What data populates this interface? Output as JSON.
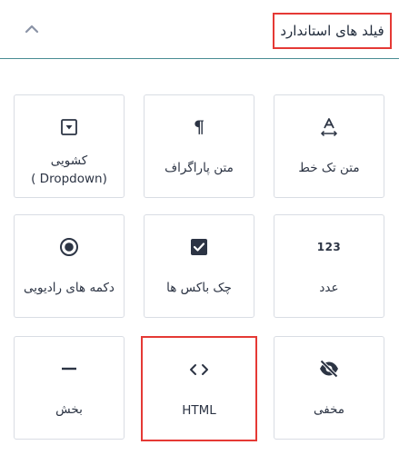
{
  "section": {
    "title": "فیلد های استاندارد",
    "collapse_icon": "chevron-up-icon"
  },
  "fields": [
    {
      "id": "single-line-text",
      "label": "متن تک خط",
      "icon": "text-width-icon"
    },
    {
      "id": "paragraph-text",
      "label": "متن پاراگراف",
      "icon": "pilcrow-icon"
    },
    {
      "id": "dropdown",
      "label": "کشویی",
      "label_sub": "( Dropdown)",
      "icon": "dropdown-select-icon"
    },
    {
      "id": "number",
      "label": "عدد",
      "icon": "number-icon",
      "icon_text": "123"
    },
    {
      "id": "checkboxes",
      "label": "چک باکس ها",
      "icon": "checkbox-icon"
    },
    {
      "id": "radio-buttons",
      "label": "دکمه های رادیویی",
      "icon": "radio-button-icon"
    },
    {
      "id": "hidden",
      "label": "مخفی",
      "icon": "eye-off-icon"
    },
    {
      "id": "html",
      "label": "HTML",
      "icon": "code-icon"
    },
    {
      "id": "section-break",
      "label": "بخش",
      "icon": "horizontal-rule-icon"
    }
  ],
  "colors": {
    "highlight": "#e53935",
    "tile_border": "#d9dde4",
    "text": "#2c3444",
    "divider": "#4a8c93",
    "chevron": "#8a93a6"
  }
}
